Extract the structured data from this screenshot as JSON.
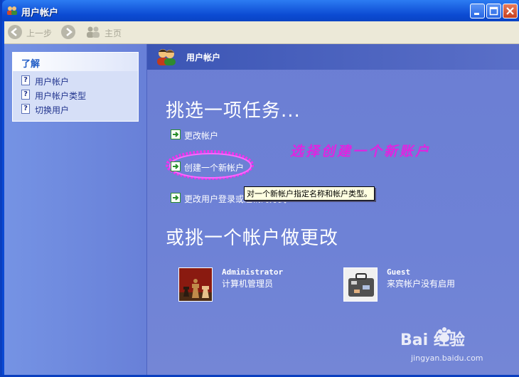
{
  "window": {
    "title": "用户帐户"
  },
  "toolbar": {
    "back_label": "上一步",
    "home_label": "主页"
  },
  "sidebar": {
    "panel_title": "了解",
    "items": [
      {
        "label": "用户帐户"
      },
      {
        "label": "用户帐户类型"
      },
      {
        "label": "切换用户"
      }
    ]
  },
  "main": {
    "header_title": "用户帐户",
    "task_heading": "挑选一项任务...",
    "tasks": [
      {
        "label": "更改帐户"
      },
      {
        "label": "创建一个新帐户"
      },
      {
        "label": "更改用户登录或注销的方式"
      }
    ],
    "tooltip": "对一个新帐户指定名称和帐户类型。",
    "annotation": "选择创建一个新账户",
    "accounts_heading": "或挑一个帐户做更改",
    "accounts": [
      {
        "name": "Administrator",
        "desc": "计算机管理员"
      },
      {
        "name": "Guest",
        "desc": "来宾帐户没有启用"
      }
    ]
  },
  "watermark": {
    "brand": "Bai  经验",
    "url": "jingyan.baidu.com"
  },
  "colors": {
    "annotation": "#e024e0",
    "titlebar": "#0a49d4",
    "main_bg": "#6d82d6"
  }
}
